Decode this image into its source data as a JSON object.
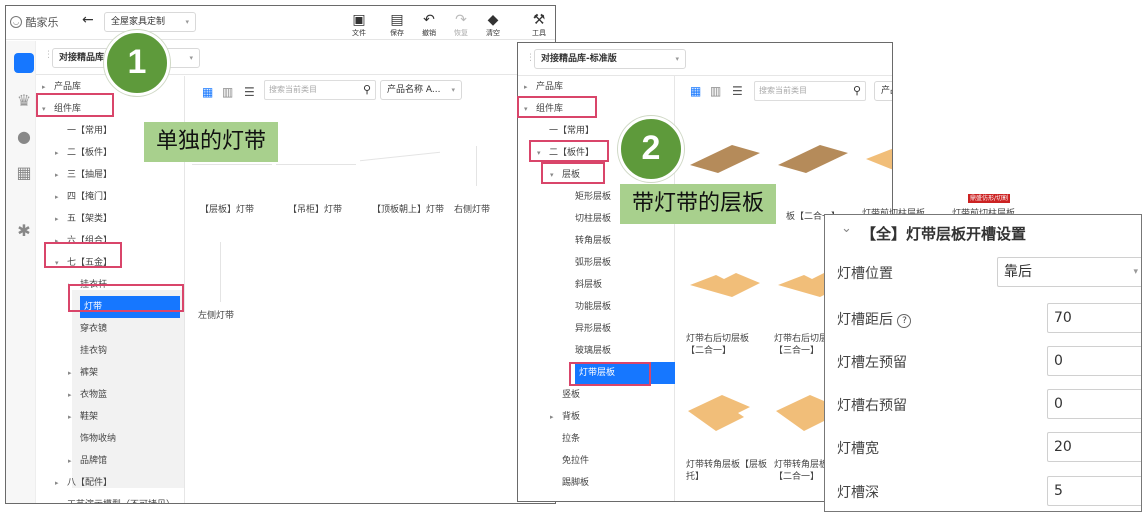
{
  "app": {
    "logo": "酷家乐",
    "dropdown": "全屋家具定制"
  },
  "toolbar": {
    "file": "文件",
    "save": "保存",
    "undo": "撤销",
    "redo": "恢复",
    "clear": "清空",
    "tools": "工具"
  },
  "left_panel": {
    "library_select": "对接精品库",
    "search_placeholder": "搜索当前类目",
    "sort_select": "产品名称 A...",
    "tree": [
      {
        "label": "产品库",
        "level": 0,
        "arrow": "▸"
      },
      {
        "label": "组件库",
        "level": 0,
        "arrow": "▾"
      },
      {
        "label": "一【常用】",
        "level": 1,
        "arrow": ""
      },
      {
        "label": "二【板件】",
        "level": 1,
        "arrow": "▸"
      },
      {
        "label": "三【抽屉】",
        "level": 1,
        "arrow": "▸"
      },
      {
        "label": "四【掩门】",
        "level": 1,
        "arrow": "▸"
      },
      {
        "label": "五【架类】",
        "level": 1,
        "arrow": "▸"
      },
      {
        "label": "六【组合】",
        "level": 1,
        "arrow": "▸"
      },
      {
        "label": "七【五金】",
        "level": 1,
        "arrow": "▾"
      },
      {
        "label": "挂衣杆",
        "level": 2,
        "arrow": "▸"
      },
      {
        "label": "灯带",
        "level": 2,
        "arrow": "",
        "selected": true
      },
      {
        "label": "穿衣镜",
        "level": 2,
        "arrow": ""
      },
      {
        "label": "挂衣钩",
        "level": 2,
        "arrow": ""
      },
      {
        "label": "裤架",
        "level": 2,
        "arrow": "▸"
      },
      {
        "label": "衣物篮",
        "level": 2,
        "arrow": "▸"
      },
      {
        "label": "鞋架",
        "level": 2,
        "arrow": "▸"
      },
      {
        "label": "饰物收纳",
        "level": 2,
        "arrow": ""
      },
      {
        "label": "品牌馆",
        "level": 2,
        "arrow": "▸"
      },
      {
        "label": "八【配件】",
        "level": 1,
        "arrow": "▸"
      },
      {
        "label": "工艺演示模型（不可拷贝）",
        "level": 1,
        "arrow": "▸"
      }
    ],
    "products": [
      "【层板】灯带",
      "【吊柜】灯带",
      "【顶板朝上】灯带",
      "右侧灯带",
      "左侧灯带"
    ]
  },
  "callout1": {
    "number": "1",
    "text": "单独的灯带"
  },
  "callout2": {
    "number": "2",
    "text": "带灯带的层板"
  },
  "mid_panel": {
    "library_select": "对接精品库-标准版",
    "search_placeholder": "搜索当前类目",
    "sort_select": "产品名称 A...",
    "tree": [
      {
        "label": "产品库",
        "level": 0,
        "arrow": "▸"
      },
      {
        "label": "组件库",
        "level": 0,
        "arrow": "▾"
      },
      {
        "label": "一【常用】",
        "level": 1,
        "arrow": ""
      },
      {
        "label": "二【板件】",
        "level": 1,
        "arrow": "▾"
      },
      {
        "label": "层板",
        "level": 2,
        "arrow": "▾"
      },
      {
        "label": "矩形层板",
        "level": 3,
        "arrow": ""
      },
      {
        "label": "切柱层板",
        "level": 3,
        "arrow": ""
      },
      {
        "label": "转角层板",
        "level": 3,
        "arrow": ""
      },
      {
        "label": "弧形层板",
        "level": 3,
        "arrow": ""
      },
      {
        "label": "斜层板",
        "level": 3,
        "arrow": ""
      },
      {
        "label": "功能层板",
        "level": 3,
        "arrow": ""
      },
      {
        "label": "异形层板",
        "level": 3,
        "arrow": ""
      },
      {
        "label": "玻璃层板",
        "level": 3,
        "arrow": ""
      },
      {
        "label": "灯带层板",
        "level": 3,
        "arrow": "",
        "selected": true
      },
      {
        "label": "竖板",
        "level": 2,
        "arrow": ""
      },
      {
        "label": "背板",
        "level": 2,
        "arrow": "▸"
      },
      {
        "label": "拉条",
        "level": 2,
        "arrow": ""
      },
      {
        "label": "免拉件",
        "level": 2,
        "arrow": ""
      },
      {
        "label": "踢脚板",
        "level": 2,
        "arrow": ""
      }
    ],
    "products": [
      "板【二合一】",
      "灯带前切柱层板",
      "灯带前切柱层板",
      "灯带右后切层板【二合一】",
      "灯带右后切层板【三合一】",
      "灯带转角层板【层板托】",
      "灯带转角层板【二合一】"
    ],
    "badge": "鼎盛仿形/切割"
  },
  "settings": {
    "title": "【全】灯带层板开槽设置",
    "rows": [
      {
        "label": "灯槽位置",
        "value": "靠后"
      },
      {
        "label": "灯槽距后",
        "value": "70"
      },
      {
        "label": "灯槽左预留",
        "value": "0"
      },
      {
        "label": "灯槽右预留",
        "value": "0"
      },
      {
        "label": "灯槽宽",
        "value": "20"
      },
      {
        "label": "灯槽深",
        "value": "5"
      }
    ]
  },
  "colors": {
    "highlight": "#d9456a",
    "selected": "#1677ff",
    "green": "#5e9a3b",
    "green_label": "#a8d08d",
    "wood_dark": "#b58b5a",
    "wood_light": "#f1be79"
  }
}
